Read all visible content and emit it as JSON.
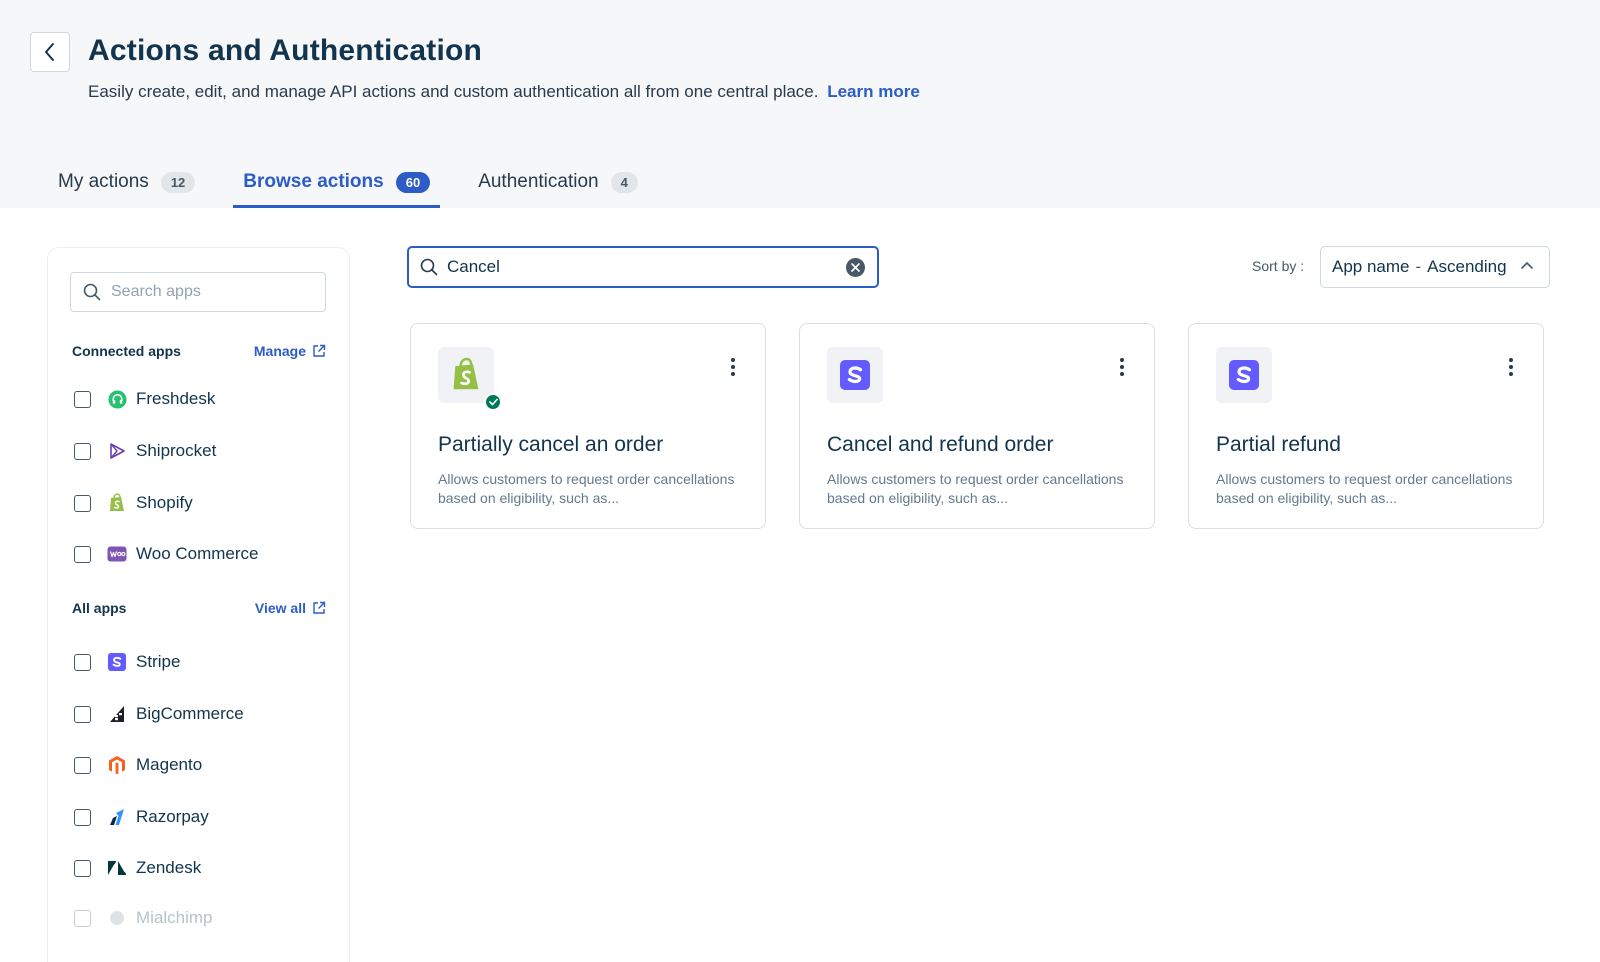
{
  "header": {
    "title": "Actions and Authentication",
    "subtitle": "Easily create, edit, and manage API actions and custom authentication all from one central place.",
    "learn_more": "Learn more"
  },
  "tabs": [
    {
      "label": "My actions",
      "count": "12"
    },
    {
      "label": "Browse actions",
      "count": "60"
    },
    {
      "label": "Authentication",
      "count": "4"
    }
  ],
  "sidebar": {
    "search_placeholder": "Search apps",
    "connected_label": "Connected apps",
    "manage_label": "Manage",
    "connected_apps": [
      {
        "name": "Freshdesk"
      },
      {
        "name": "Shiprocket"
      },
      {
        "name": "Shopify"
      },
      {
        "name": "Woo Commerce"
      }
    ],
    "all_label": "All apps",
    "view_all_label": "View all",
    "all_apps": [
      {
        "name": "Stripe"
      },
      {
        "name": "BigCommerce"
      },
      {
        "name": "Magento"
      },
      {
        "name": "Razorpay"
      },
      {
        "name": "Zendesk"
      },
      {
        "name": "Mialchimp"
      }
    ]
  },
  "search": {
    "value": "Cancel"
  },
  "sort": {
    "label": "Sort by :",
    "field": "App name",
    "order": "Ascending"
  },
  "cards": [
    {
      "title": "Partially cancel an order",
      "description": "Allows customers to request order cancellations based on eligibility, such as..."
    },
    {
      "title": "Cancel and refund order",
      "description": "Allows customers to request order cancellations based on eligibility, such as..."
    },
    {
      "title": "Partial refund",
      "description": "Allows customers to request order cancellations based on eligibility, such as..."
    }
  ],
  "colors": {
    "accent": "#2c5cc5",
    "success": "#00795b",
    "stripe": "#635bff",
    "shopify": "#95bf47"
  }
}
